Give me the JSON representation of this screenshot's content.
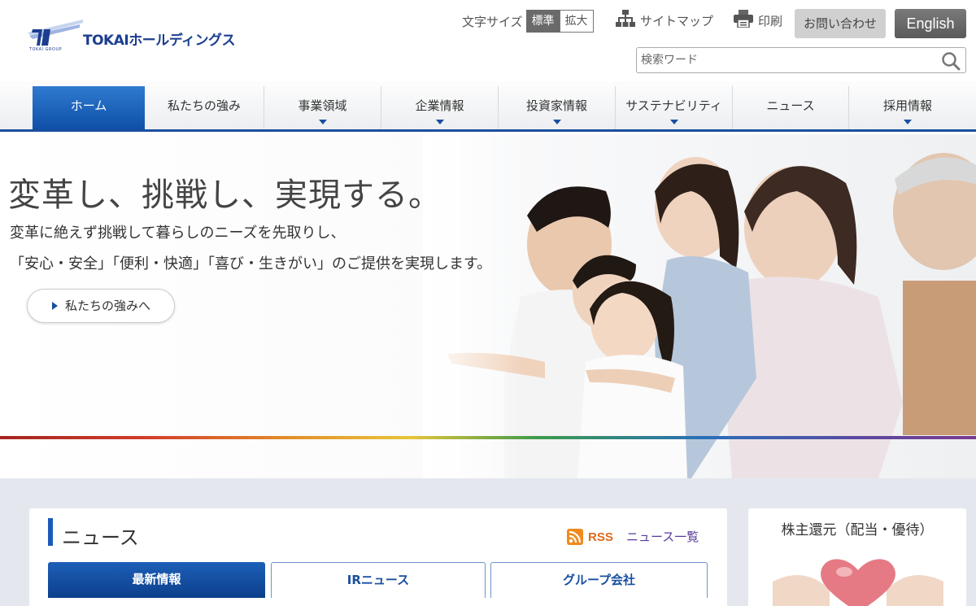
{
  "header": {
    "logo_text": "TOKAIホールディングス",
    "logo_sub": "TOKAI GROUP",
    "font_size_label": "文字サイズ",
    "font_size_standard": "標準",
    "font_size_large": "拡大",
    "sitemap_label": "サイトマップ",
    "print_label": "印刷",
    "contact_label": "お問い合わせ",
    "english_label": "English",
    "search_placeholder": "検索ワード"
  },
  "nav": {
    "items": [
      {
        "label": "ホーム",
        "active": true,
        "has_dropdown": false
      },
      {
        "label": "私たちの強み",
        "active": false,
        "has_dropdown": false
      },
      {
        "label": "事業領域",
        "active": false,
        "has_dropdown": true
      },
      {
        "label": "企業情報",
        "active": false,
        "has_dropdown": true
      },
      {
        "label": "投資家情報",
        "active": false,
        "has_dropdown": true
      },
      {
        "label": "サステナビリティ",
        "active": false,
        "has_dropdown": true
      },
      {
        "label": "ニュース",
        "active": false,
        "has_dropdown": false
      },
      {
        "label": "採用情報",
        "active": false,
        "has_dropdown": true
      }
    ]
  },
  "hero": {
    "title": "変革し、挑戦し、実現する。",
    "line1": "変革に絶えず挑戦して暮らしのニーズを先取りし、",
    "line2": "「安心・安全」「便利・快適」「喜び・生きがい」のご提供を実現します。",
    "button_label": "私たちの強みへ"
  },
  "news": {
    "title": "ニュース",
    "rss_label": "RSS",
    "list_link": "ニュース一覧",
    "tabs": [
      {
        "label": "最新情報",
        "active": true
      },
      {
        "label": "IRニュース",
        "active": false
      },
      {
        "label": "グループ会社",
        "active": false
      }
    ]
  },
  "side": {
    "title": "株主還元（配当・優待）"
  },
  "colors": {
    "brand_blue": "#1a4fa0",
    "rss_orange": "#f08a1e",
    "link_purple": "#5a3a9a"
  }
}
